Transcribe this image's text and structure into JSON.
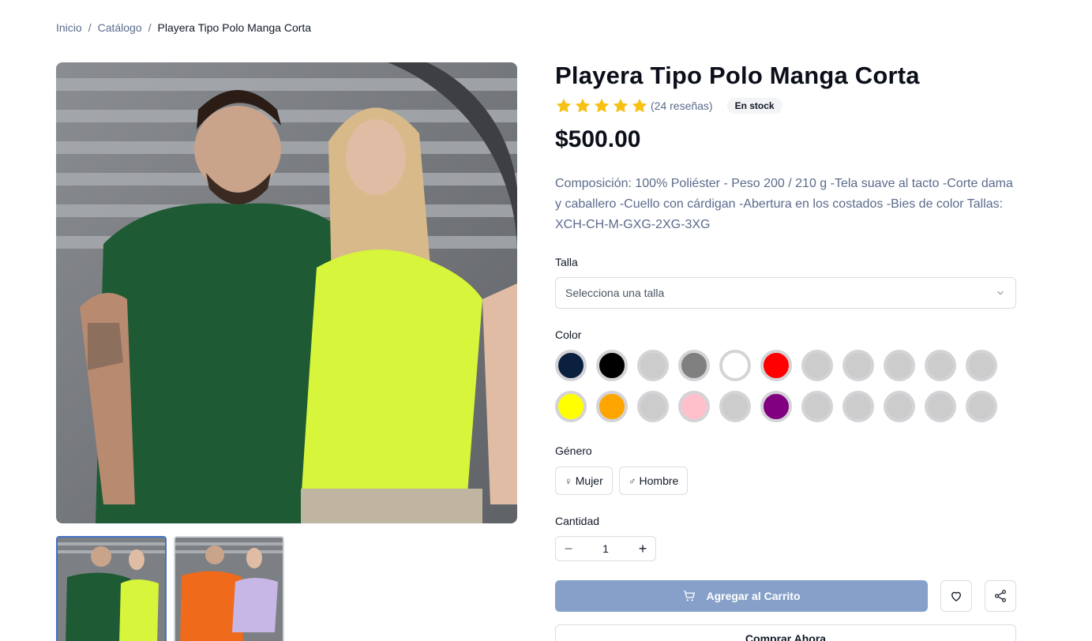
{
  "breadcrumb": {
    "home": "Inicio",
    "catalog": "Catálogo",
    "current": "Playera Tipo Polo Manga Corta",
    "separator": "/"
  },
  "product": {
    "title": "Playera Tipo Polo Manga Corta",
    "rating_stars": 5,
    "reviews": "(24 reseñas)",
    "stock": "En stock",
    "price": "$500.00",
    "description": "Composición: 100% Poliéster - Peso 200 / 210 g -Tela suave al tacto -Corte dama y caballero -Cuello con cárdigan -Abertura en los costados -Bies de color Tallas: XCH-CH-M-GXG-2XG-3XG"
  },
  "size": {
    "label": "Talla",
    "placeholder": "Selecciona una talla"
  },
  "color": {
    "label": "Color",
    "swatches": [
      "#0b1f3f",
      "#000000",
      "#cccccc",
      "#808080",
      "#ffffff",
      "#ff0000",
      "#cccccc",
      "#cccccc",
      "#cccccc",
      "#cccccc",
      "#cccccc",
      "#ffff00",
      "#ffa500",
      "#cccccc",
      "#ffc0cb",
      "#cccccc",
      "#800080",
      "#cccccc",
      "#cccccc",
      "#cccccc",
      "#cccccc",
      "#cccccc"
    ]
  },
  "gender": {
    "label": "Género",
    "female": "Mujer",
    "male": "Hombre",
    "female_icon": "♀",
    "male_icon": "♂"
  },
  "quantity": {
    "label": "Cantidad",
    "value": "1",
    "minus": "−",
    "plus": "+"
  },
  "actions": {
    "add_to_cart": "Agregar al Carrito",
    "buy_now": "Comprar Ahora"
  },
  "colors": {
    "accent_button": "#86a0c9",
    "link": "#5b6b8c",
    "star": "#f6c114",
    "thumb_active_border": "#4472c4"
  }
}
